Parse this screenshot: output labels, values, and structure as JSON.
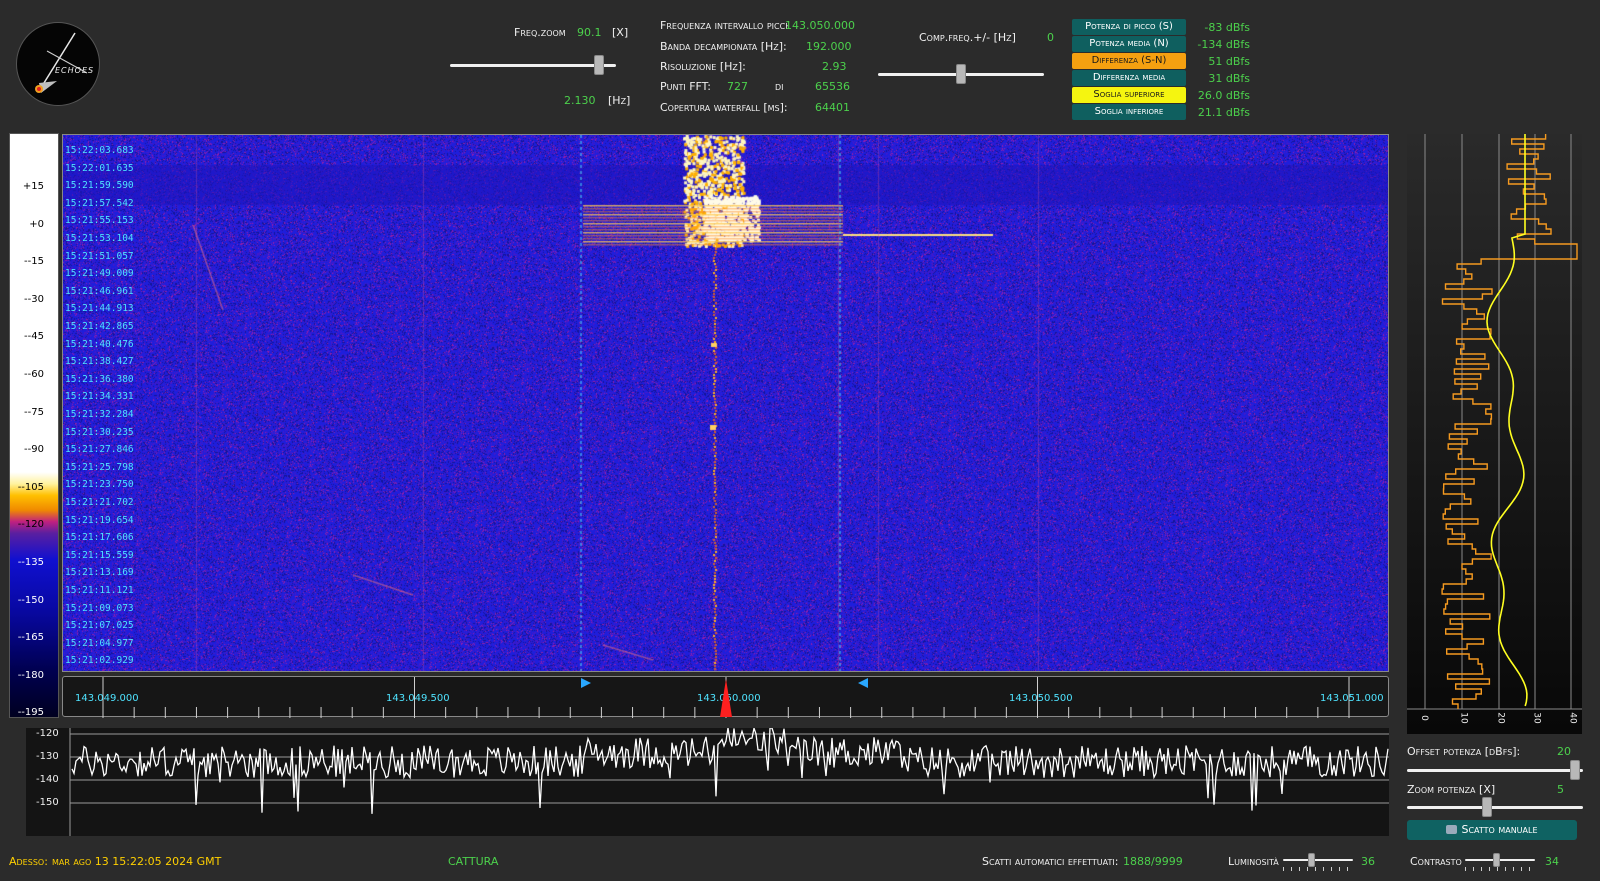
{
  "logo": {
    "text": "ECHOES"
  },
  "zoom": {
    "label": "Freq.zoom",
    "value": "90.1",
    "unit": "[X]",
    "hz_value": "2.130",
    "hz_unit": "[Hz]",
    "slider_level": 0.92
  },
  "info": {
    "rows": [
      {
        "label": "Frequenza intervallo picchi [Hz]:",
        "value": "143.050.000"
      },
      {
        "label": "Banda decampionata [Hz]:",
        "value": "192.000"
      },
      {
        "label": "Risoluzione [Hz]:",
        "value": "2.93"
      },
      {
        "label": "Copertura waterfall [ms]:",
        "value": "64401"
      }
    ],
    "fft_label": "Punti FFT:",
    "fft_value": "727",
    "fft_of": "di",
    "fft_total": "65536"
  },
  "comp": {
    "label": "Comp.freq.+/- [Hz]",
    "value": "0",
    "slider_level": 0.5
  },
  "legend": [
    {
      "label": "Potenza di picco (S)",
      "value": "-83 dBfs",
      "bg": "#0f5f5f",
      "fg": "#ffffff"
    },
    {
      "label": "Potenza media (N)",
      "value": "-134 dBfs",
      "bg": "#0f5f5f",
      "fg": "#ffffff"
    },
    {
      "label": "Differenza (S-N)",
      "value": "51 dBfs",
      "bg": "#f5a010",
      "fg": "#1a1a1a"
    },
    {
      "label": "Differenza media",
      "value": "31 dBfs",
      "bg": "#0f5f5f",
      "fg": "#ffffff"
    },
    {
      "label": "Soglia superiore",
      "value": "26.0 dBfs",
      "bg": "#f5f510",
      "fg": "#1a1a1a"
    },
    {
      "label": "Soglia inferiore",
      "value": "21.1 dBfs",
      "bg": "#0f5f5f",
      "fg": "#ffffff"
    }
  ],
  "scale_labels": [
    "+15",
    "+0",
    "--15",
    "--30",
    "--45",
    "--60",
    "--75",
    "--90",
    "--105",
    "--120",
    "--135",
    "--150",
    "--165",
    "--180",
    "--195"
  ],
  "timestamps": [
    "15:22:03.683",
    "15:22:01.635",
    "15:21:59.590",
    "15:21:57.542",
    "15:21:55.153",
    "15:21:53.104",
    "15:21:51.057",
    "15:21:49.009",
    "15:21:46.961",
    "15:21:44.913",
    "15:21:42.865",
    "15:21:40.476",
    "15:21:38.427",
    "15:21:36.380",
    "15:21:34.331",
    "15:21:32.284",
    "15:21:30.235",
    "15:21:27.846",
    "15:21:25.798",
    "15:21:23.750",
    "15:21:21.702",
    "15:21:19.654",
    "15:21:17.606",
    "15:21:15.559",
    "15:21:13.169",
    "15:21:11.121",
    "15:21:09.073",
    "15:21:07.025",
    "15:21:04.977",
    "15:21:02.929"
  ],
  "freq_labels": [
    "143.049.000",
    "143.049.500",
    "143.050.000",
    "143.050.500",
    "143.051.000"
  ],
  "spectrum_ticks": [
    "-120",
    "-130",
    "-140",
    "-150"
  ],
  "side_ticks": [
    "0",
    "10",
    "20",
    "30",
    "40"
  ],
  "offset": {
    "label": "Offset potenza [dBfs]:",
    "value": "20",
    "slider_level": 0.98
  },
  "pzoom": {
    "label": "Zoom potenza [X]",
    "value": "5",
    "slider_level": 0.45
  },
  "manual_btn": {
    "label": "Scatto manuale"
  },
  "status": {
    "now_label": "Adesso:",
    "now_value": "mar ago 13 15:22:05 2024 GMT",
    "mode": "CATTURA",
    "shots_label": "Scatti automatici effettuati:",
    "shots_value": "1888/9999",
    "brightness_label": "Luminosità",
    "brightness_value": "36",
    "brightness_level": 0.4,
    "contrast_label": "Contrasto",
    "contrast_value": "34",
    "contrast_level": 0.45
  }
}
